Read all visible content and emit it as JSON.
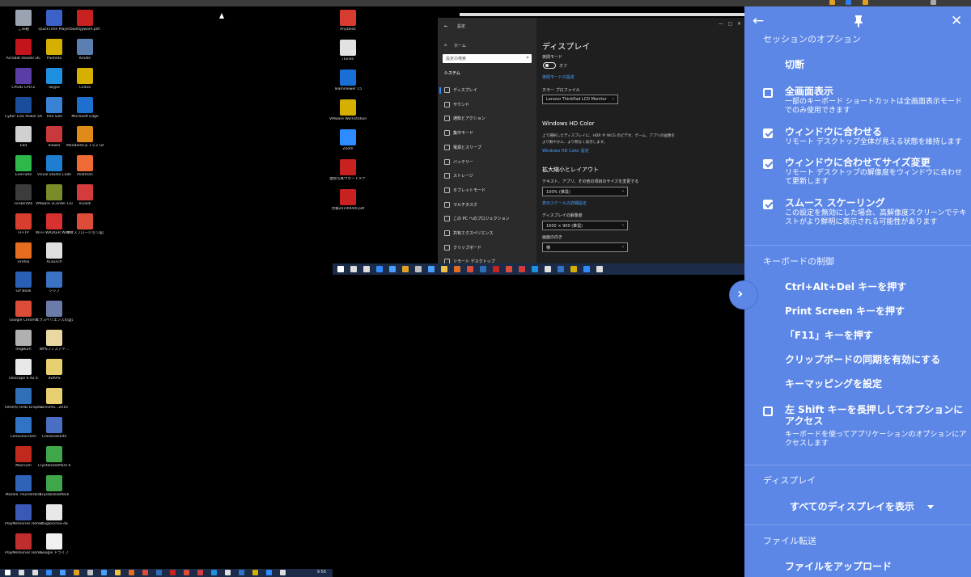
{
  "desktop": {
    "icons_col1": [
      {
        "label": "ごみ箱",
        "color": "#9aa4b0"
      },
      {
        "label": "Acrobat Reader DC",
        "color": "#c4141b"
      },
      {
        "label": "CPUID CPU-Z",
        "color": "#5a3ea8"
      },
      {
        "label": "Cyber Link Power DVD 19",
        "color": "#1b4d9c"
      },
      {
        "label": "Edit",
        "color": "#d0d0d0"
      },
      {
        "label": "Evernote",
        "color": "#2db84b"
      },
      {
        "label": "FireBirdAll",
        "color": "#3c3c3c"
      },
      {
        "label": "FFFTP",
        "color": "#d93d2d"
      },
      {
        "label": "Firefox",
        "color": "#e66c1f"
      },
      {
        "label": "Gif Book",
        "color": "#2a5fb8"
      },
      {
        "label": "Google Chrome",
        "color": "#dd4b39"
      },
      {
        "label": "ImgBurn",
        "color": "#b0b0b0"
      },
      {
        "label": "Inkscape 0.92.4",
        "color": "#e8e8e8"
      },
      {
        "label": "Intel(R) UHD Graphics Contr...",
        "color": "#2f6fb7"
      },
      {
        "label": "LenovoScreen",
        "color": "#3173c4"
      },
      {
        "label": "Macrium",
        "color": "#c2291e"
      },
      {
        "label": "Mozilla Thunderbird",
        "color": "#2f63b8"
      },
      {
        "label": "PlayMemories Home ヘルプ",
        "color": "#3a58b8"
      },
      {
        "label": "PlayMemories Home",
        "color": "#bf2d2d"
      }
    ],
    "icons_col2": [
      {
        "label": "QuickTime Player",
        "color": "#3b62c7"
      },
      {
        "label": "Plumeto",
        "color": "#d6b000"
      },
      {
        "label": "Skype",
        "color": "#1e90e0"
      },
      {
        "label": "Tree Size",
        "color": "#3a82d4"
      },
      {
        "label": "Viewer",
        "color": "#c9393b"
      },
      {
        "label": "Visual Studio Code",
        "color": "#1f7ecf"
      },
      {
        "label": "VMware vCenter Converter Stan...",
        "color": "#7a8c2a"
      },
      {
        "label": "Wi-Fi WALKER WiMAX 7+ setti...",
        "color": "#d93030"
      },
      {
        "label": "XLaunch",
        "color": "#e0e0e0"
      },
      {
        "label": "シップ",
        "color": "#3a72c4"
      },
      {
        "label": "エクスペリエンスの設定ツール",
        "color": "#6b7ca8"
      },
      {
        "label": "WPSフィスアド...",
        "color": "#e9d9a0"
      },
      {
        "label": "4DAPS",
        "color": "#e8d070"
      },
      {
        "label": "ionivmS...2016",
        "color": "#e8d070"
      },
      {
        "label": "CrossDiskInfo",
        "color": "#4a6fc2"
      },
      {
        "label": "CrystalDiskMark 6",
        "color": "#3fa64a"
      },
      {
        "label": "CrystalDiskMark",
        "color": "#3fa64a"
      },
      {
        "label": "daigloncreo-da",
        "color": "#e8e8e8"
      },
      {
        "label": "Google ドライブ",
        "color": "#f0f0f0"
      }
    ],
    "icons_col3": [
      {
        "label": "bootsjpwarn.pdf",
        "color": "#c7221f"
      },
      {
        "label": "Kindle",
        "color": "#5b7fb0"
      },
      {
        "label": "Lirava",
        "color": "#d6b000"
      },
      {
        "label": "Microsoft Edge",
        "color": "#1f6fce"
      },
      {
        "label": "MenBarto-p 1.5.2 (x64)",
        "color": "#e08a1a"
      },
      {
        "label": "Postman",
        "color": "#f06a35"
      },
      {
        "label": "Vivaldi",
        "color": "#d43c3c"
      },
      {
        "label": "エクスプロージョン設定パージ",
        "color": "#dd4b39"
      }
    ],
    "icons_col4": [
      {
        "label": "AnyDesk",
        "color": "#d63c2f"
      },
      {
        "label": "iTunes",
        "color": "#e2e2e2"
      },
      {
        "label": "TeamViewer 15",
        "color": "#1a6fd6"
      },
      {
        "label": "VMware Workstation...",
        "color": "#d6b000"
      },
      {
        "label": "Zoom",
        "color": "#2d8cff"
      },
      {
        "label": "連続写真ウポートメテルの記用の手引...",
        "color": "#c7221f"
      },
      {
        "label": "見積20190000.pdf",
        "color": "#c7221f"
      }
    ]
  },
  "settings_window": {
    "title": "設定",
    "home": "ホーム",
    "search_placeholder": "設定の検索",
    "group": "システム",
    "nav_items": [
      "ディスプレイ",
      "サウンド",
      "通知とアクション",
      "集中モード",
      "電源とスリープ",
      "バッテリー",
      "ストレージ",
      "タブレットモード",
      "マルチタスク",
      "この PC へのプロジェクション",
      "共有エクスペリエンス",
      "クリップボード",
      "リモート デスクトップ"
    ],
    "page_title": "ディスプレイ",
    "night_mode": "夜間モード",
    "night_mode_state": "オフ",
    "night_link": "夜間モードの設定",
    "color_profile": "カラー プロファイル",
    "color_profile_value": "Lenovo ThinkPad LCD Monitor",
    "hd_color": "Windows HD Color",
    "hd_text_1": "上で選択したディスプレイに、HDR や WCG のビデオ、ゲーム、アプリの画像を",
    "hd_text_2": "より鮮やかに、より明るく表示します。",
    "hd_link": "Windows HD Color 設定",
    "scale_title": "拡大縮小とレイアウト",
    "scale_label": "テキスト、アプリ、その他の項目のサイズを変更する",
    "scale_value": "100% (推奨)",
    "scale_link": "表示スケールの詳細設定",
    "resolution_label": "ディスプレイの解像度",
    "resolution_value": "1600 × 900 (推奨)",
    "orientation_label": "画面の向き",
    "orientation_value": "横"
  },
  "taskbar_time": "9:56",
  "panel": {
    "back_icon": "←",
    "pin_icon": "pin-icon",
    "close_icon": "✕",
    "session_header": "セッションのオプション",
    "disconnect": "切断",
    "options": [
      {
        "title": "全画面表示",
        "desc": "一部のキーボード ショートカットは全画面表示モードでのみ使用できます",
        "checked": false
      },
      {
        "title": "ウィンドウに合わせる",
        "desc": "リモート デスクトップ全体が見える状態を維持します",
        "checked": true
      },
      {
        "title": "ウィンドウに合わせてサイズ変更",
        "desc": "リモート デスクトップの解像度をウィンドウに合わせて更新します",
        "checked": true
      },
      {
        "title": "スムース スケーリング",
        "desc": "この設定を無効にした場合、高解像度スクリーンでテキストがより鮮明に表示される可能性があります",
        "checked": true
      }
    ],
    "keyboard_header": "キーボードの制御",
    "keyboard_actions": [
      "Ctrl+Alt+Del キーを押す",
      "Print Screen キーを押す",
      "「F11」キーを押す",
      "クリップボードの同期を有効にする",
      "キーマッピングを設定"
    ],
    "shift_option": {
      "title": "左 Shift キーを長押ししてオプションにアクセス",
      "desc": "キーボードを使ってアプリケーションのオプションにアクセスします",
      "checked": false
    },
    "display_header": "ディスプレイ",
    "display_select": "すべてのディスプレイを表示",
    "file_header": "ファイル転送",
    "upload": "ファイルをアップロード",
    "tab_icon": "›"
  }
}
